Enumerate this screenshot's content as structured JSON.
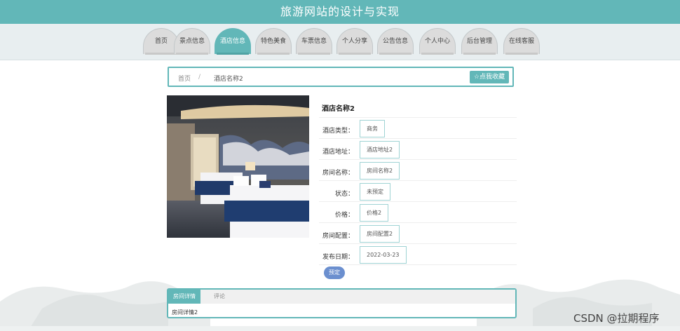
{
  "site": {
    "title": "旅游网站的设计与实现"
  },
  "nav": {
    "items": [
      {
        "label": "首页",
        "active": false
      },
      {
        "label": "景点信息",
        "active": false
      },
      {
        "label": "酒店信息",
        "active": true
      },
      {
        "label": "特色美食",
        "active": false
      },
      {
        "label": "车票信息",
        "active": false
      },
      {
        "label": "个人分享",
        "active": false
      },
      {
        "label": "公告信息",
        "active": false
      },
      {
        "label": "个人中心",
        "active": false
      },
      {
        "label": "后台管理",
        "active": false
      },
      {
        "label": "在线客服",
        "active": false
      }
    ]
  },
  "breadcrumb": {
    "home": "首页",
    "separator": "/",
    "current": "酒店名称2"
  },
  "favorite_button": "☆点我收藏",
  "hotel": {
    "name": "酒店名称2",
    "fields": [
      {
        "label": "酒店类型：",
        "value": "商务"
      },
      {
        "label": "酒店地址：",
        "value": "酒店地址2"
      },
      {
        "label": "房间名称：",
        "value": "房间名称2"
      },
      {
        "label": "状态：",
        "value": "未预定"
      },
      {
        "label": "价格：",
        "value": "价格2"
      },
      {
        "label": "房间配置：",
        "value": "房间配置2"
      },
      {
        "label": "发布日期：",
        "value": "2022-03-23"
      }
    ]
  },
  "book_button": "预定",
  "detail": {
    "tabs": [
      {
        "label": "房间详情",
        "active": true
      },
      {
        "label": "评论",
        "active": false
      }
    ],
    "content": "房间详情2"
  },
  "watermark": "CSDN @拉期程序",
  "colors": {
    "accent": "#62b7b8",
    "button_blue": "#6b8fcf"
  }
}
